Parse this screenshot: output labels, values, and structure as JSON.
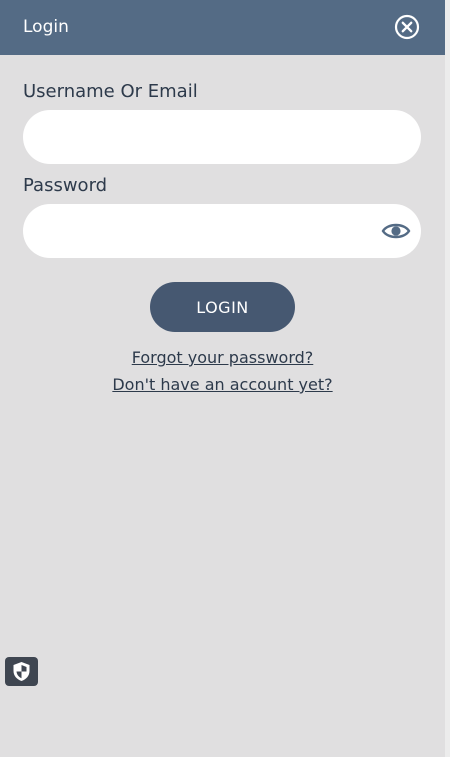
{
  "header": {
    "title": "Login",
    "close_icon": "close-circle-icon"
  },
  "form": {
    "username_label": "Username Or Email",
    "username_value": "",
    "password_label": "Password",
    "password_value": "",
    "show_password_icon": "eye-icon",
    "login_label": "LOGIN"
  },
  "links": {
    "forgot": "Forgot your password?",
    "signup": "Don't have an account yet?"
  },
  "privacy_badge": {
    "icon": "shield-icon"
  },
  "colors": {
    "header_bg": "#546b85",
    "panel_bg": "#e0dfe0",
    "button_bg": "#465871",
    "text": "#2d3a4b"
  }
}
